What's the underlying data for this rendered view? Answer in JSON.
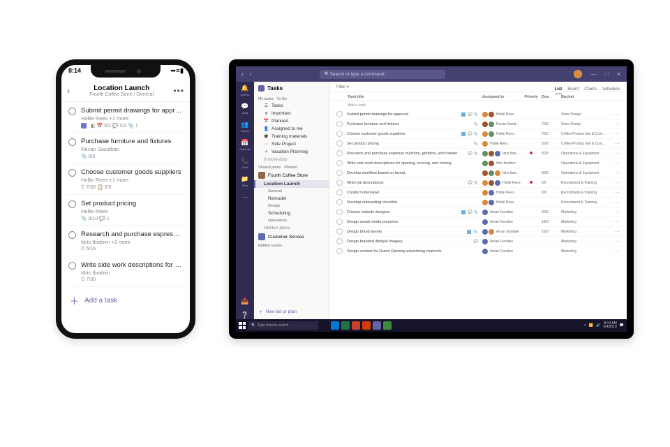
{
  "phone": {
    "status_time": "8:14",
    "signal_text": "••• ≡ ▮",
    "header_title": "Location Launch",
    "header_subtitle": "Fourth Coffee Store / General",
    "tasks": [
      {
        "title": "Submit permit drawings for approval",
        "subtitle": "Hollie Rees +1 more",
        "meta": "◧  📅 0/2  💬 0/2  📎 1",
        "accent": true
      },
      {
        "title": "Purchase furniture and fixtures",
        "subtitle": "Revan Sasidhan",
        "meta": "📎 0/6"
      },
      {
        "title": "Choose customer goods suppliers",
        "subtitle": "Hollie Rees +1 more",
        "meta": "⏱ 7/30  📋 2/6"
      },
      {
        "title": "Set product pricing",
        "subtitle": "Hollie Rees",
        "meta": "📎 0/10  💬 1"
      },
      {
        "title": "Research and purchase espresso…",
        "subtitle": "Idris Ibrahim +2 more",
        "meta": "⏱ 5/16"
      },
      {
        "title": "Write side work descriptions for op…",
        "subtitle": "Idris Ibrahim",
        "meta": "⏱ 7/30"
      }
    ],
    "add_task_label": "Add a task"
  },
  "tablet": {
    "search_placeholder": "Search or type a command",
    "rail": [
      {
        "icon": "🔔",
        "label": "Activity"
      },
      {
        "icon": "💬",
        "label": "Chat"
      },
      {
        "icon": "👥",
        "label": "Teams"
      },
      {
        "icon": "📅",
        "label": "Calendar"
      },
      {
        "icon": "📞",
        "label": "Calls"
      },
      {
        "icon": "📁",
        "label": "Files"
      },
      {
        "icon": "⋯",
        "label": ""
      }
    ],
    "sidebar": {
      "app_title": "Tasks",
      "section_my": "My tasks · To Do",
      "my_items": [
        {
          "icon": "☰",
          "label": "Tasks"
        },
        {
          "icon": "★",
          "label": "Important"
        },
        {
          "icon": "📅",
          "label": "Planned"
        },
        {
          "icon": "👤",
          "label": "Assigned to me"
        },
        {
          "icon": "🎓",
          "label": "Training materials"
        },
        {
          "icon": "⋯",
          "label": "Side Project"
        },
        {
          "icon": "✈",
          "label": "Vacation Planning"
        }
      ],
      "more_label": "6 more lists",
      "section_shared": "Shared plans · Planner",
      "team_name": "Fourth Coffee Store",
      "channels": [
        {
          "label": "Location Launch",
          "sub": "General",
          "selected": true
        },
        {
          "label": "Remodel",
          "sub": "Design"
        },
        {
          "label": "Scheduling",
          "sub": "Operations"
        }
      ],
      "hidden_label": "Hidden plans",
      "cs_label": "Customer Service",
      "hidden_teams": "Hidden teams",
      "new_list": "New list or plan"
    },
    "main": {
      "tab_filter_l": "Filter ▾",
      "tabs_r": [
        "List",
        "Board",
        "Charts",
        "Schedule"
      ],
      "active_tab": "List",
      "columns": {
        "title": "Task title",
        "assigned": "Assigned to",
        "priority": "Priority",
        "due": "Due",
        "bucket": "Bucket"
      },
      "add_row": "Add a task",
      "rows": [
        {
          "title": "Submit permit drawings for approval",
          "icons": "ca",
          "accent": true,
          "avs": [
            "a1",
            "a2"
          ],
          "name": "Hollie Rees",
          "pri": "",
          "due": "",
          "bucket": "Store Design"
        },
        {
          "title": "Purchase furniture and fixtures",
          "icons": "a",
          "avs": [
            "a2",
            "a3"
          ],
          "name": "Revan Sasidhan",
          "pri": "",
          "due": "7/20",
          "bucket": "Store Design"
        },
        {
          "title": "Choose customer goods suppliers",
          "icons": "ca",
          "accent": true,
          "avs": [
            "a1",
            "a3"
          ],
          "name": "Hollie Rees",
          "pri": "",
          "due": "7/20",
          "bucket": "Coffee Product line & Cost…"
        },
        {
          "title": "Set product pricing",
          "icons": "a",
          "avs": [
            "a1"
          ],
          "name": "Hollie Rees",
          "pri": "",
          "due": "5/16",
          "bucket": "Coffee Product line & Cost…"
        },
        {
          "title": "Research and purchase espresso machine, grinders, and roaster",
          "icons": "ca",
          "avs": [
            "a3",
            "a2",
            "a4"
          ],
          "name": "Idris Ibrahim",
          "pri": "red",
          "due": "5/23",
          "bucket": "Operations & Equipment"
        },
        {
          "title": "Write side work descriptions for opening, running, and closing",
          "icons": "",
          "avs": [
            "a3",
            "a2"
          ],
          "name": "Idris Ibrahim",
          "pri": "",
          "due": "",
          "bucket": "Operations & Equipment"
        },
        {
          "title": "Develop workflow based on layout",
          "icons": "",
          "avs": [
            "a2",
            "a3",
            "a1"
          ],
          "name": "Idris Ibrahim",
          "pri": "",
          "due": "6/25",
          "bucket": "Operations & Equipment"
        },
        {
          "title": "Write job descriptions",
          "icons": "ca",
          "avs": [
            "a1",
            "a2",
            "a4"
          ],
          "name": "Hollie Rees",
          "pri": "red",
          "due": "6/6",
          "bucket": "Recruitment & Training"
        },
        {
          "title": "Conduct interviews",
          "icons": "",
          "avs": [
            "a1",
            "a4"
          ],
          "name": "Hollie Rees",
          "pri": "",
          "due": "6/6",
          "bucket": "Recruitment & Training"
        },
        {
          "title": "Develop onboarding checklist",
          "icons": "",
          "avs": [
            "a1",
            "a4"
          ],
          "name": "Hollie Rees",
          "pri": "",
          "due": "",
          "bucket": "Recruitment & Training"
        },
        {
          "title": "Choose website designer",
          "icons": "ca",
          "accent": true,
          "avs": [
            "a4"
          ],
          "name": "Amari Gondwe",
          "pri": "",
          "due": "2/15",
          "bucket": "Marketing"
        },
        {
          "title": "Design social media presence",
          "icons": "",
          "avs": [
            "a4"
          ],
          "name": "Amari Gondwe",
          "pri": "",
          "due": "10/3",
          "bucket": "Marketing"
        },
        {
          "title": "Design brand assets",
          "icons": "a",
          "accent": true,
          "avs": [
            "a4",
            "a1"
          ],
          "name": "Amari Gondwe",
          "pri": "",
          "due": "10/3",
          "bucket": "Marketing"
        },
        {
          "title": "Design branded lifestyle imagery",
          "icons": "c",
          "avs": [
            "a4"
          ],
          "name": "Amari Gondwe",
          "pri": "",
          "due": "",
          "bucket": "Marketing"
        },
        {
          "title": "Design content for Grand Opening advertising channels",
          "icons": "",
          "avs": [
            "a4"
          ],
          "name": "Amari Gondwe",
          "pri": "",
          "due": "",
          "bucket": "Marketing"
        }
      ]
    },
    "taskbar": {
      "search": "Type here to search",
      "time": "8:14 AM",
      "date": "5/4/2019"
    }
  }
}
